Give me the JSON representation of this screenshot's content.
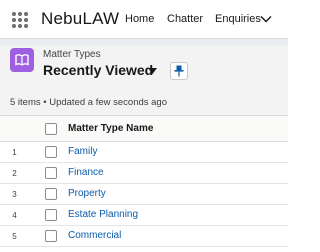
{
  "app": {
    "name": "NebuLAW",
    "waffle_icon": "app-launcher-icon"
  },
  "nav": {
    "items": [
      {
        "label": "Home"
      },
      {
        "label": "Chatter"
      },
      {
        "label": "Enquiries"
      }
    ],
    "more_icon": "chevron-down-icon"
  },
  "header": {
    "object_type": "Matter Types",
    "object_icon": "book-icon",
    "object_icon_color": "#9e5fe0",
    "view_name": "Recently Viewed",
    "view_switch_icon": "caret-down-icon",
    "pin_icon": "pin-icon",
    "status": "5 items • Updated a few seconds ago"
  },
  "table": {
    "columns": [
      "Matter Type Name"
    ],
    "rows": [
      {
        "num": "1",
        "name": "Family"
      },
      {
        "num": "2",
        "name": "Finance"
      },
      {
        "num": "3",
        "name": "Property"
      },
      {
        "num": "4",
        "name": "Estate Planning"
      },
      {
        "num": "5",
        "name": "Commercial"
      }
    ]
  },
  "colors": {
    "link": "#0b5cab",
    "header_band": "#f3f3f3"
  }
}
